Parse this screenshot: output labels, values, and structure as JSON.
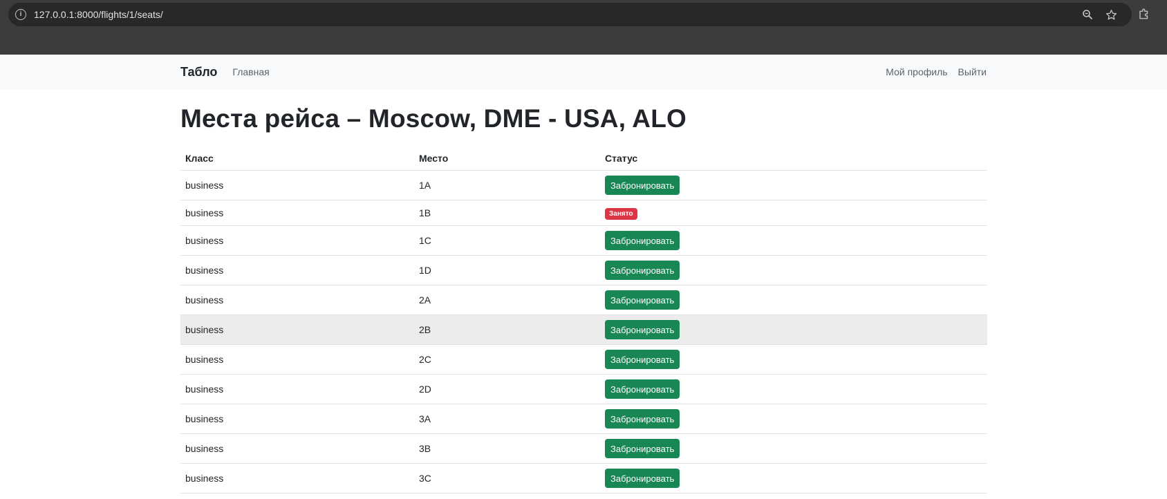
{
  "browser": {
    "url": "127.0.0.1:8000/flights/1/seats/",
    "icons": [
      "info-icon",
      "zoom-icon",
      "star-icon",
      "extensions-icon"
    ]
  },
  "navbar": {
    "brand": "Табло",
    "home": "Главная",
    "profile": "Мой профиль",
    "logout": "Выйти"
  },
  "page": {
    "title": "Места рейса – Moscow, DME - USA, ALO"
  },
  "table": {
    "headers": [
      "Класс",
      "Место",
      "Статус"
    ],
    "book_label": "Забронировать",
    "taken_label": "Занято",
    "rows": [
      {
        "class": "business",
        "seat": "1A",
        "status": "available"
      },
      {
        "class": "business",
        "seat": "1B",
        "status": "taken"
      },
      {
        "class": "business",
        "seat": "1C",
        "status": "available"
      },
      {
        "class": "business",
        "seat": "1D",
        "status": "available"
      },
      {
        "class": "business",
        "seat": "2A",
        "status": "available"
      },
      {
        "class": "business",
        "seat": "2B",
        "status": "available"
      },
      {
        "class": "business",
        "seat": "2C",
        "status": "available"
      },
      {
        "class": "business",
        "seat": "2D",
        "status": "available"
      },
      {
        "class": "business",
        "seat": "3A",
        "status": "available"
      },
      {
        "class": "business",
        "seat": "3B",
        "status": "available"
      },
      {
        "class": "business",
        "seat": "3C",
        "status": "available"
      }
    ]
  },
  "colors": {
    "success": "#198754",
    "danger": "#dc3545",
    "navbar_bg": "#f8f9fa"
  }
}
